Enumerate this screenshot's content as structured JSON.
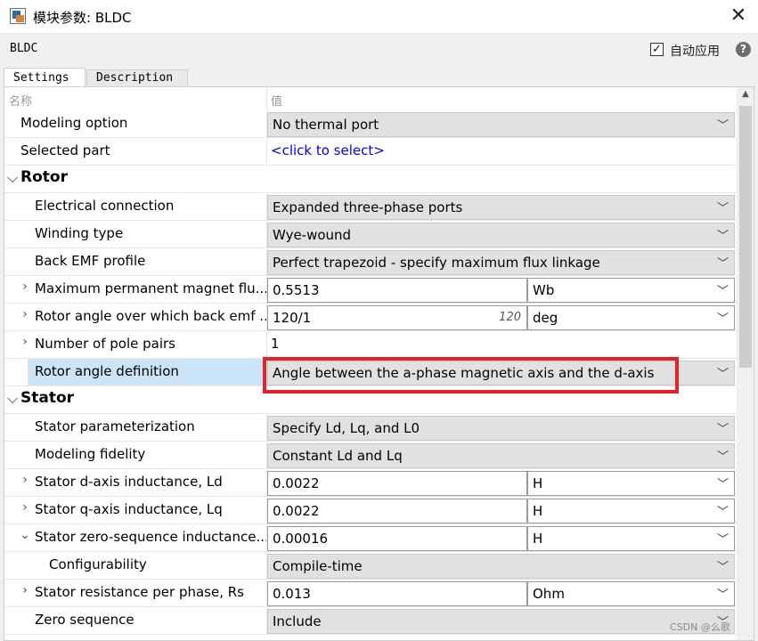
{
  "window": {
    "title": "模块参数: BLDC",
    "close_glyph": "✕"
  },
  "header": {
    "block_name": "BLDC",
    "auto_apply_label": "自动应用",
    "auto_apply_checked": "✓",
    "help_glyph": "?"
  },
  "tabs": [
    {
      "label": "Settings"
    },
    {
      "label": "Description"
    }
  ],
  "table": {
    "name_header": "名称",
    "value_header": "值"
  },
  "rows": {
    "modeling_option": {
      "label": "Modeling option",
      "value": "No thermal port"
    },
    "selected_part": {
      "label": "Selected part",
      "value": "<click to select>"
    },
    "rotor_group": {
      "label": "Rotor"
    },
    "electrical_connection": {
      "label": "Electrical connection",
      "value": "Expanded three-phase ports"
    },
    "winding_type": {
      "label": "Winding type",
      "value": "Wye-wound"
    },
    "back_emf_profile": {
      "label": "Back EMF profile",
      "value": "Perfect trapezoid - specify maximum flux linkage"
    },
    "max_pm_flux": {
      "label": "Maximum permanent magnet flu...",
      "value": "0.5513",
      "unit": "Wb"
    },
    "rotor_angle_back_emf": {
      "label": "Rotor angle over which back emf ...",
      "value": "120/1",
      "hint": "120",
      "unit": "deg"
    },
    "pole_pairs": {
      "label": "Number of pole pairs",
      "value": "1"
    },
    "rotor_angle_definition": {
      "label": "Rotor angle definition",
      "value": "Angle between the a-phase magnetic axis and the d-axis"
    },
    "stator_group": {
      "label": "Stator"
    },
    "stator_param": {
      "label": "Stator parameterization",
      "value": "Specify Ld, Lq, and L0"
    },
    "modeling_fidelity": {
      "label": "Modeling fidelity",
      "value": "Constant Ld and Lq"
    },
    "ld": {
      "label": "Stator d-axis inductance, Ld",
      "value": "0.0022",
      "unit": "H"
    },
    "lq": {
      "label": "Stator q-axis inductance, Lq",
      "value": "0.0022",
      "unit": "H"
    },
    "l0": {
      "label": "Stator zero-sequence inductance...",
      "value": "0.00016",
      "unit": "H"
    },
    "configurability": {
      "label": "Configurability",
      "value": "Compile-time"
    },
    "rs": {
      "label": "Stator resistance per phase, Rs",
      "value": "0.013",
      "unit": "Ohm"
    },
    "zero_sequence": {
      "label": "Zero sequence",
      "value": "Include"
    }
  },
  "glyphs": {
    "caret": "﹀",
    "collapsed": "›",
    "expanded": "⌄",
    "group_expanded": "⌵",
    "scroll_up": "▲"
  },
  "watermark": "CSDN @么歌"
}
